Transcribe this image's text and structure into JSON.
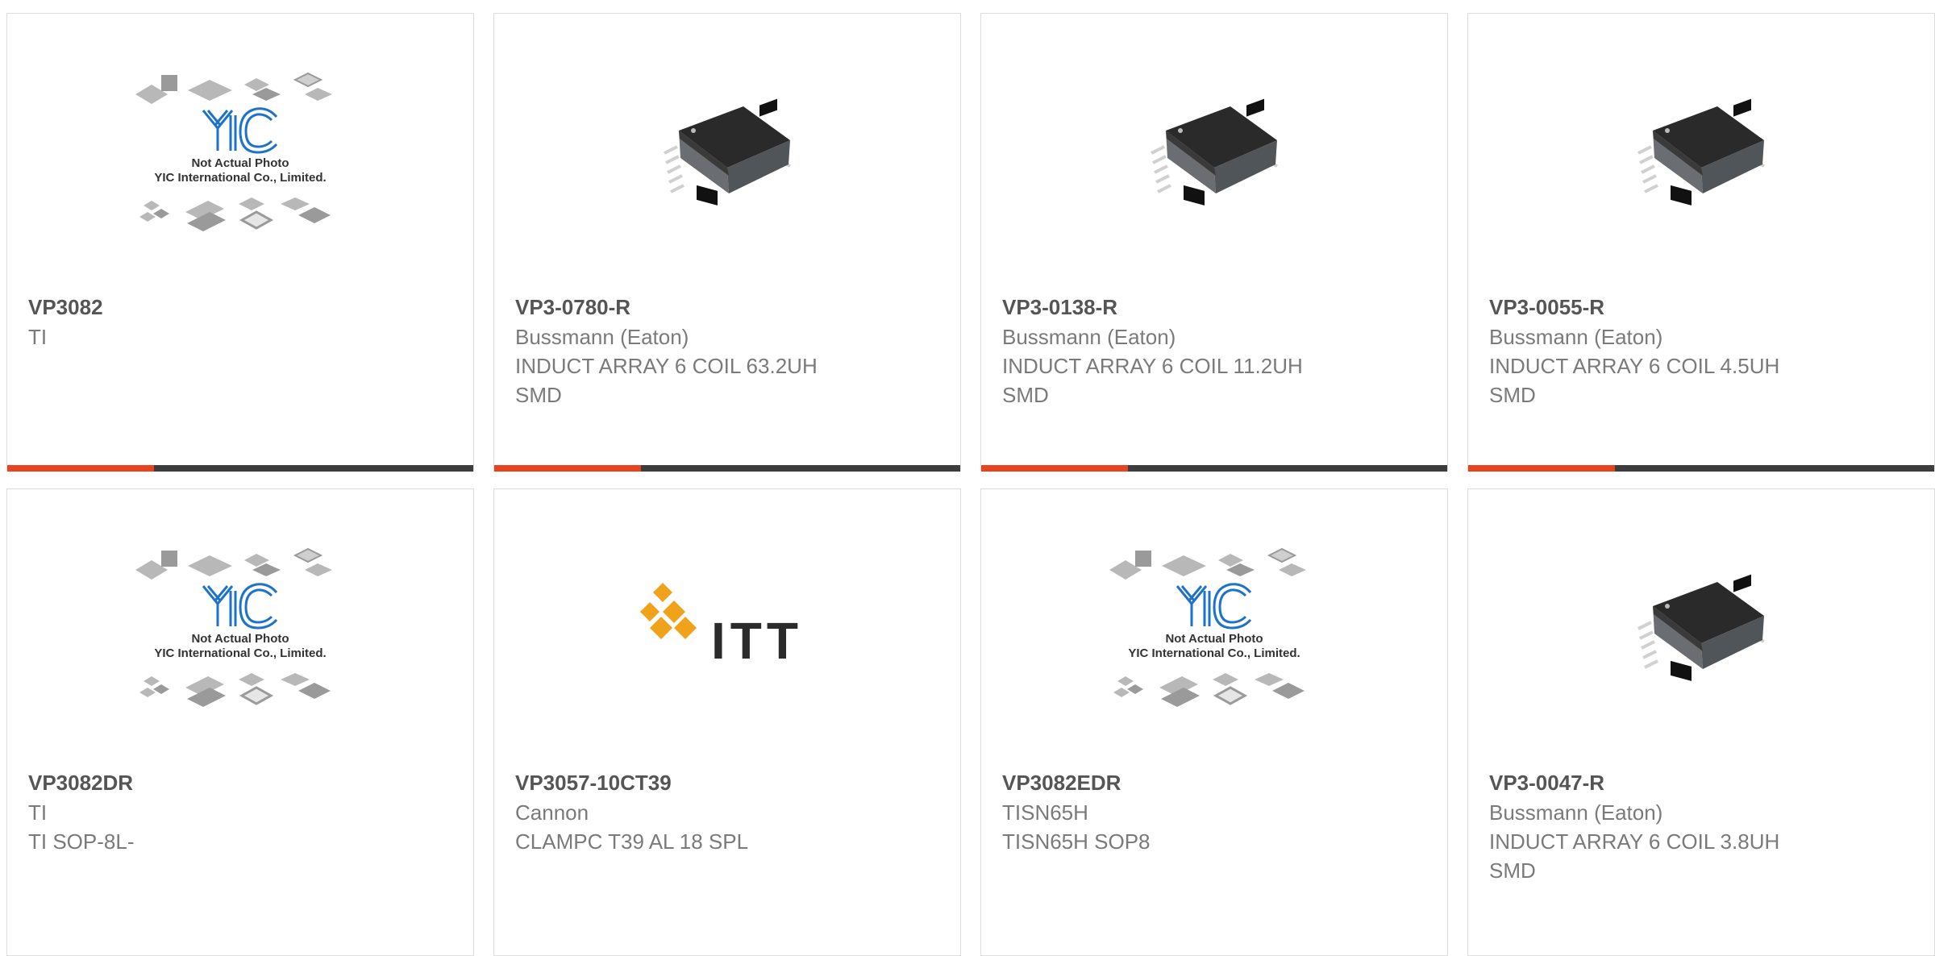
{
  "products": [
    {
      "part": "VP3082",
      "lines": [
        "TI"
      ],
      "image": "yic-placeholder",
      "placeholder_text": [
        "Not Actual Photo",
        "YIC International Co., Limited."
      ]
    },
    {
      "part": "VP3-0780-R",
      "lines": [
        "Bussmann (Eaton)",
        "INDUCT ARRAY 6 COIL 63.2UH",
        "SMD"
      ],
      "image": "smd-inductor"
    },
    {
      "part": "VP3-0138-R",
      "lines": [
        "Bussmann (Eaton)",
        "INDUCT ARRAY 6 COIL 11.2UH",
        "SMD"
      ],
      "image": "smd-inductor"
    },
    {
      "part": "VP3-0055-R",
      "lines": [
        "Bussmann (Eaton)",
        "INDUCT ARRAY 6 COIL 4.5UH",
        "SMD"
      ],
      "image": "smd-inductor"
    },
    {
      "part": "VP3082DR",
      "lines": [
        "TI",
        "TI SOP-8L-"
      ],
      "image": "yic-placeholder",
      "placeholder_text": [
        "Not Actual Photo",
        "YIC International Co., Limited."
      ]
    },
    {
      "part": "VP3057-10CT39",
      "lines": [
        "Cannon",
        "CLAMPC T39 AL 18 SPL"
      ],
      "image": "itt-logo",
      "logo_text": "ITT"
    },
    {
      "part": "VP3082EDR",
      "lines": [
        "TISN65H",
        "TISN65H SOP8"
      ],
      "image": "yic-placeholder",
      "placeholder_text": [
        "Not Actual Photo",
        "YIC International Co., Limited."
      ]
    },
    {
      "part": "VP3-0047-R",
      "lines": [
        "Bussmann (Eaton)",
        "INDUCT ARRAY 6 COIL 3.8UH",
        "SMD"
      ],
      "image": "smd-inductor"
    }
  ],
  "colors": {
    "accent": "#e8431e",
    "bar": "#3d3d3d",
    "yic_blue": "#1e73c8",
    "itt_gold": "#f0a21a"
  }
}
